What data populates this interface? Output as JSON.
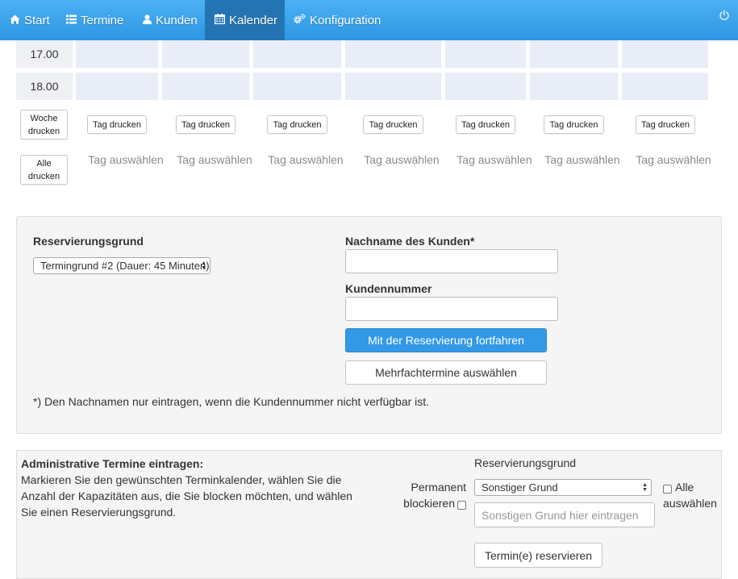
{
  "nav": {
    "items": [
      {
        "label": "Start",
        "icon": "home-icon",
        "active": false
      },
      {
        "label": "Termine",
        "icon": "list-icon",
        "active": false
      },
      {
        "label": "Kunden",
        "icon": "user-icon",
        "active": false
      },
      {
        "label": "Kalender",
        "icon": "calendar-icon",
        "active": true
      },
      {
        "label": "Konfiguration",
        "icon": "cogs-icon",
        "active": false
      }
    ],
    "power_icon": "power-icon"
  },
  "calendar": {
    "times": [
      "17.00",
      "18.00"
    ],
    "week_print": "Woche drucken",
    "all_print": "Alle drucken",
    "day_print": "Tag drucken",
    "day_select": "Tag auswählen"
  },
  "reservation": {
    "reason_label": "Reservierungsgrund",
    "reason_value": "Termingrund #2 (Dauer: 45 Minuten)",
    "lastname_label": "Nachname des Kunden*",
    "lastname_value": "",
    "customer_no_label": "Kundennummer",
    "customer_no_value": "",
    "continue_button": "Mit der Reservierung fortfahren",
    "multi_button": "Mehrfachtermine auswählen",
    "note": "*) Den Nachnamen nur eintragen, wenn die Kundennummer nicht verfügbar ist."
  },
  "admin": {
    "title": "Administrative Termine eintragen:",
    "description": "Markieren Sie den gewünschten Terminkalender, wählen Sie die Anzahl der Kapazitäten aus, die Sie blocken möchten, und wählen Sie einen Reservierungsgrund.",
    "permanent_label_1": "Permanent",
    "permanent_label_2": "blockieren",
    "reason_label": "Reservierungsgrund",
    "reason_value": "Sonstiger Grund",
    "other_placeholder": "Sonstigen Grund hier eintragen",
    "select_all_1": "Alle",
    "select_all_2": "auswählen",
    "submit_button": "Termin(e) reservieren"
  },
  "colors": {
    "nav_top": "#4cb1f4",
    "nav_bottom": "#2d96e2",
    "nav_active": "#2474b4",
    "slot": "#e9edf8",
    "primary_button": "#3399e6"
  }
}
